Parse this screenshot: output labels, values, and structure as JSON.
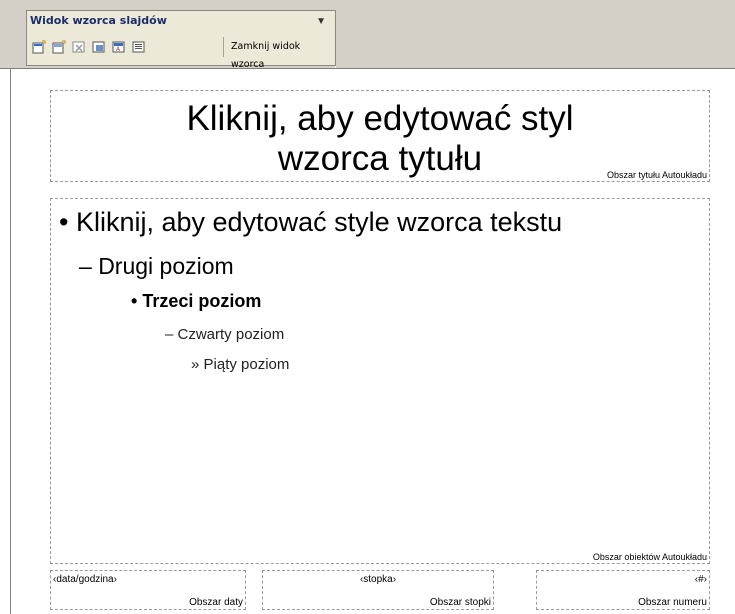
{
  "toolbar": {
    "title": "Widok wzorca slajdów",
    "menu_arrow": "▼",
    "close_label": "Zamknij widok wzorca",
    "icons": [
      "insert-slide-master-icon",
      "insert-title-master-icon",
      "delete-master-icon",
      "preserve-master-icon",
      "rename-master-icon",
      "master-layout-icon"
    ]
  },
  "slide": {
    "title_placeholder": {
      "line1": "Kliknij, aby edytować styl",
      "line2": "wzorca tytułu",
      "area_label": "Obszar tytułu Autoukładu"
    },
    "body_placeholder": {
      "level1": "Kliknij, aby edytować style wzorca tekstu",
      "level2": "Drugi poziom",
      "level3": "Trzeci poziom",
      "level4": "Czwarty poziom",
      "level5": "Piąty poziom",
      "area_label": "Obszar obiektów Autoukładu"
    },
    "date_placeholder": {
      "field": "‹data/godzina›",
      "area_label": "Obszar daty"
    },
    "footer_placeholder": {
      "field": "‹stopka›",
      "area_label": "Obszar stopki"
    },
    "number_placeholder": {
      "field": "‹#›",
      "area_label": "Obszar numeru"
    }
  },
  "colors": {
    "chrome": "#d4d0c8",
    "toolbar": "#ece9d8",
    "title_text": "#1b2d6b"
  }
}
